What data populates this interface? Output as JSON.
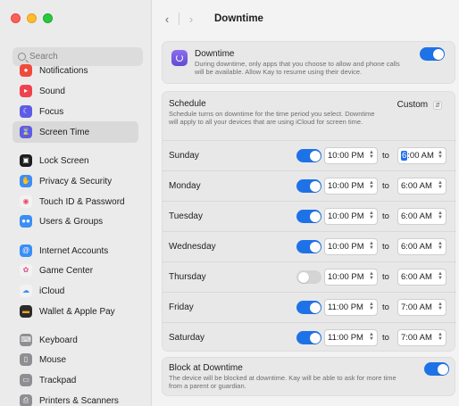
{
  "window": {
    "title": "Downtime"
  },
  "sidebar": {
    "search_placeholder": "Search",
    "items": [
      {
        "label": "Notifications",
        "icon": "bell-icon",
        "color": "#f04a3d"
      },
      {
        "label": "Sound",
        "icon": "speaker-icon",
        "color": "#f0424e"
      },
      {
        "label": "Focus",
        "icon": "moon-icon",
        "color": "#5e5ce6"
      },
      {
        "label": "Screen Time",
        "icon": "hourglass-icon",
        "color": "#5e5ce6"
      },
      {
        "label": "Lock Screen",
        "icon": "lock-screen-icon",
        "color": "#1d1d1f"
      },
      {
        "label": "Privacy & Security",
        "icon": "hand-icon",
        "color": "#3a8ef6"
      },
      {
        "label": "Touch ID & Password",
        "icon": "fingerprint-icon",
        "color": "#f2f2f2"
      },
      {
        "label": "Users & Groups",
        "icon": "users-icon",
        "color": "#3a8ef6"
      },
      {
        "label": "Internet Accounts",
        "icon": "at-icon",
        "color": "#3a8ef6"
      },
      {
        "label": "Game Center",
        "icon": "game-center-icon",
        "color": "#f2f2f2"
      },
      {
        "label": "iCloud",
        "icon": "cloud-icon",
        "color": "#f2f2f2"
      },
      {
        "label": "Wallet & Apple Pay",
        "icon": "wallet-icon",
        "color": "#2b2b2b"
      },
      {
        "label": "Keyboard",
        "icon": "keyboard-icon",
        "color": "#8e8e93"
      },
      {
        "label": "Mouse",
        "icon": "mouse-icon",
        "color": "#8e8e93"
      },
      {
        "label": "Trackpad",
        "icon": "trackpad-icon",
        "color": "#8e8e93"
      },
      {
        "label": "Printers & Scanners",
        "icon": "printer-icon",
        "color": "#8e8e93"
      }
    ],
    "selected": "Screen Time"
  },
  "downtime": {
    "title": "Downtime",
    "description": "During downtime, only apps that you choose to allow and phone calls will be available. Allow Kay to resume using their device.",
    "enabled": true
  },
  "schedule": {
    "title": "Schedule",
    "description": "Schedule turns on downtime for the time period you select. Downtime will apply to all your devices that are using iCloud for screen time.",
    "mode": "Custom",
    "to_label": "to",
    "days": [
      {
        "day": "Sunday",
        "enabled": true,
        "start": "10:00 PM",
        "end": "6:00 AM"
      },
      {
        "day": "Monday",
        "enabled": true,
        "start": "10:00 PM",
        "end": "6:00 AM"
      },
      {
        "day": "Tuesday",
        "enabled": true,
        "start": "10:00 PM",
        "end": "6:00 AM"
      },
      {
        "day": "Wednesday",
        "enabled": true,
        "start": "10:00 PM",
        "end": "6:00 AM"
      },
      {
        "day": "Thursday",
        "enabled": false,
        "start": "10:00 PM",
        "end": "6:00 AM"
      },
      {
        "day": "Friday",
        "enabled": true,
        "start": "11:00 PM",
        "end": "7:00 AM"
      },
      {
        "day": "Saturday",
        "enabled": true,
        "start": "11:00 PM",
        "end": "7:00 AM"
      }
    ]
  },
  "block": {
    "title": "Block at Downtime",
    "description": "The device will be blocked at downtime. Kay will be able to ask for more time from a parent or guardian.",
    "enabled": true
  },
  "sunday_end_hour": "6",
  "sunday_end_rest": ":00 AM"
}
